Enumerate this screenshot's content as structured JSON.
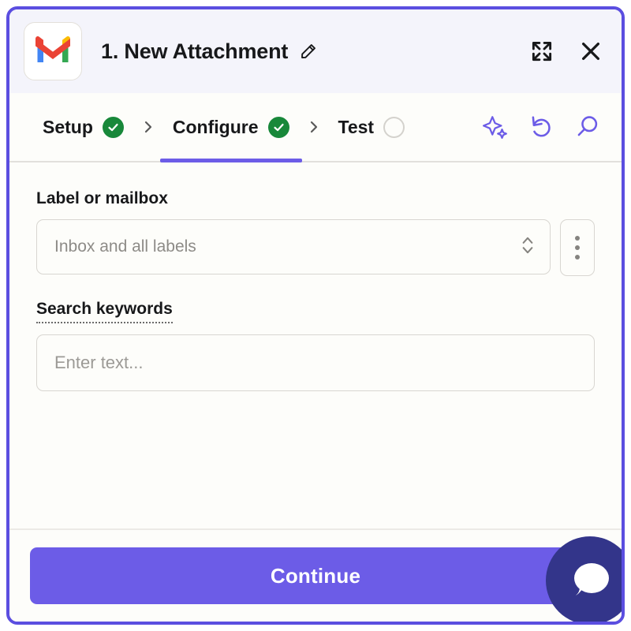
{
  "window": {
    "border_color": "#5b4ee0",
    "background": "#fdfdfa",
    "header_background": "#f4f4fb"
  },
  "header": {
    "app_icon": "gmail-icon",
    "title": "1. New Attachment",
    "edit_icon": "pencil-icon",
    "expand_icon": "expand-fullscreen-icon",
    "close_icon": "close-x-icon"
  },
  "tabs": {
    "items": [
      {
        "label": "Setup",
        "state": "done",
        "active": false,
        "status_icon": "check-circle-icon"
      },
      {
        "label": "Configure",
        "state": "done",
        "active": true,
        "status_icon": "check-circle-icon"
      },
      {
        "label": "Test",
        "state": "pending",
        "active": false,
        "status_icon": "empty-circle-icon"
      }
    ],
    "separator_icon": "chevron-right-icon",
    "active_underline_color": "#6c5ce7",
    "done_color": "#18883a",
    "actions": [
      {
        "name": "ai-sparkle-icon",
        "color": "#6c5ce7"
      },
      {
        "name": "undo-arrow-icon",
        "color": "#6c5ce7"
      },
      {
        "name": "search-magnifier-icon",
        "color": "#6c5ce7"
      }
    ]
  },
  "form": {
    "fields": [
      {
        "label": "Label or mailbox",
        "type": "select",
        "value": "",
        "placeholder": "Inbox and all labels",
        "chevron_icon": "chevron-up-down-icon",
        "kebab_icon": "more-vertical-icon",
        "has_hint": false
      },
      {
        "label": "Search keywords",
        "type": "text",
        "value": "",
        "placeholder": "Enter text...",
        "has_hint": true
      }
    ]
  },
  "footer": {
    "continue_label": "Continue",
    "continue_color": "#6c5ce7",
    "chat_icon": "chat-bubble-icon",
    "chat_bg_color": "#33358a"
  }
}
